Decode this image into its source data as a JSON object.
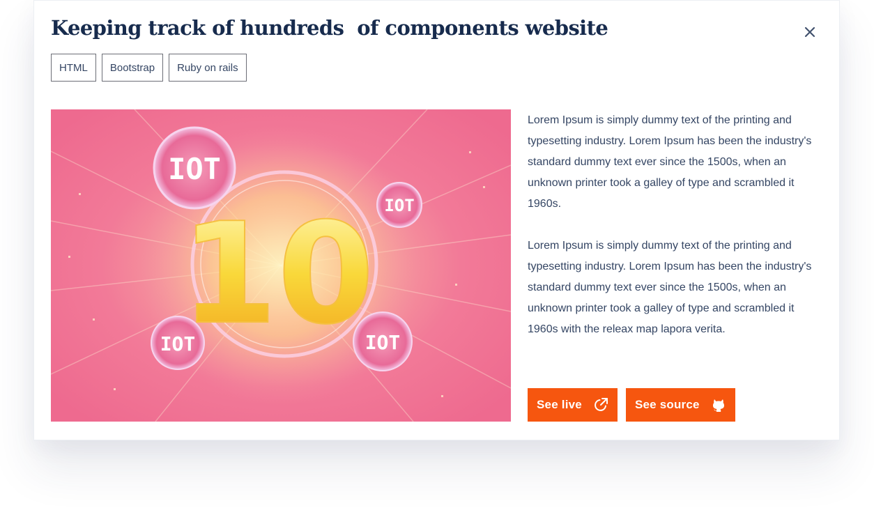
{
  "modal": {
    "title": "Keeping track of hundreds  of components website",
    "close_icon": "close-icon",
    "tags": [
      "HTML",
      "Bootstrap",
      "Ruby on rails"
    ],
    "image": {
      "number": "10",
      "badge_text": "IOT"
    },
    "description": [
      "Lorem Ipsum is simply dummy text of the printing and typesetting industry. Lorem Ipsum has been the industry's standard dummy text ever since the 1500s, when an unknown printer took a galley of type and scrambled it 1960s.",
      "Lorem Ipsum is simply dummy text of the printing and typesetting industry. Lorem Ipsum has been the industry's standard dummy text ever since the 1500s, when an unknown printer took a galley of type and scrambled it 1960s with the releax map lapora verita."
    ],
    "buttons": {
      "see_live": "See live",
      "see_live_icon": "external-link-icon",
      "see_source": "See source",
      "see_source_icon": "github-icon"
    }
  },
  "colors": {
    "title": "#172b4d",
    "accent": "#f6560f",
    "text": "#344563",
    "image_tint": "#f06b8c"
  }
}
